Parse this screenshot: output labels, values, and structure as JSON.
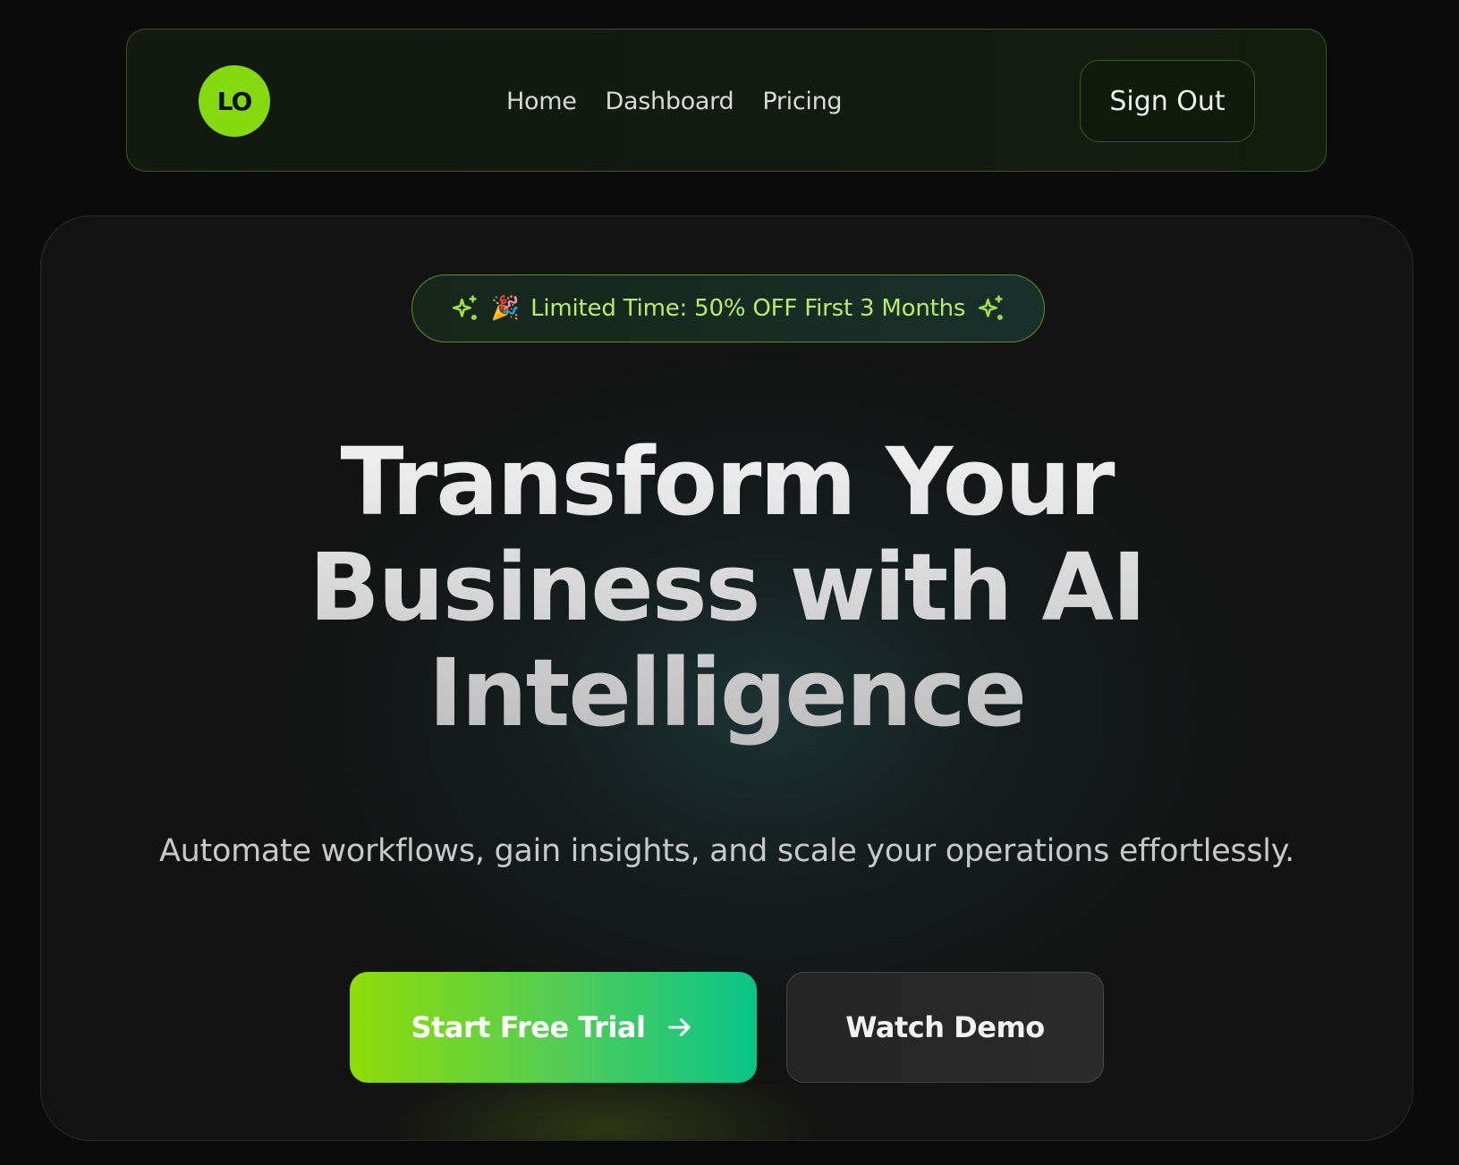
{
  "nav": {
    "logo_text": "LO",
    "links": [
      {
        "label": "Home"
      },
      {
        "label": "Dashboard"
      },
      {
        "label": "Pricing"
      }
    ],
    "sign_out_label": "Sign Out"
  },
  "hero": {
    "promo": {
      "emoji": "🎉",
      "text": "Limited Time: 50% OFF First 3 Months",
      "icons": [
        "sparkle-icon",
        "party-popper-icon",
        "sparkle-icon"
      ]
    },
    "headline_lines": [
      "Transform Your",
      "Business with AI",
      "Intelligence"
    ],
    "subtext": "Automate workflows, gain insights, and scale your operations effortlessly.",
    "primary_cta": {
      "label": "Start Free Trial",
      "icon": "arrow-right-icon"
    },
    "secondary_cta": {
      "label": "Watch Demo"
    }
  },
  "colors": {
    "page_bg": "#0b0b0b",
    "accent_green": "#84d90f",
    "promo_text": "#b7ec6c",
    "cta_gradient_start": "#8fdc06",
    "cta_gradient_end": "#08c487"
  }
}
